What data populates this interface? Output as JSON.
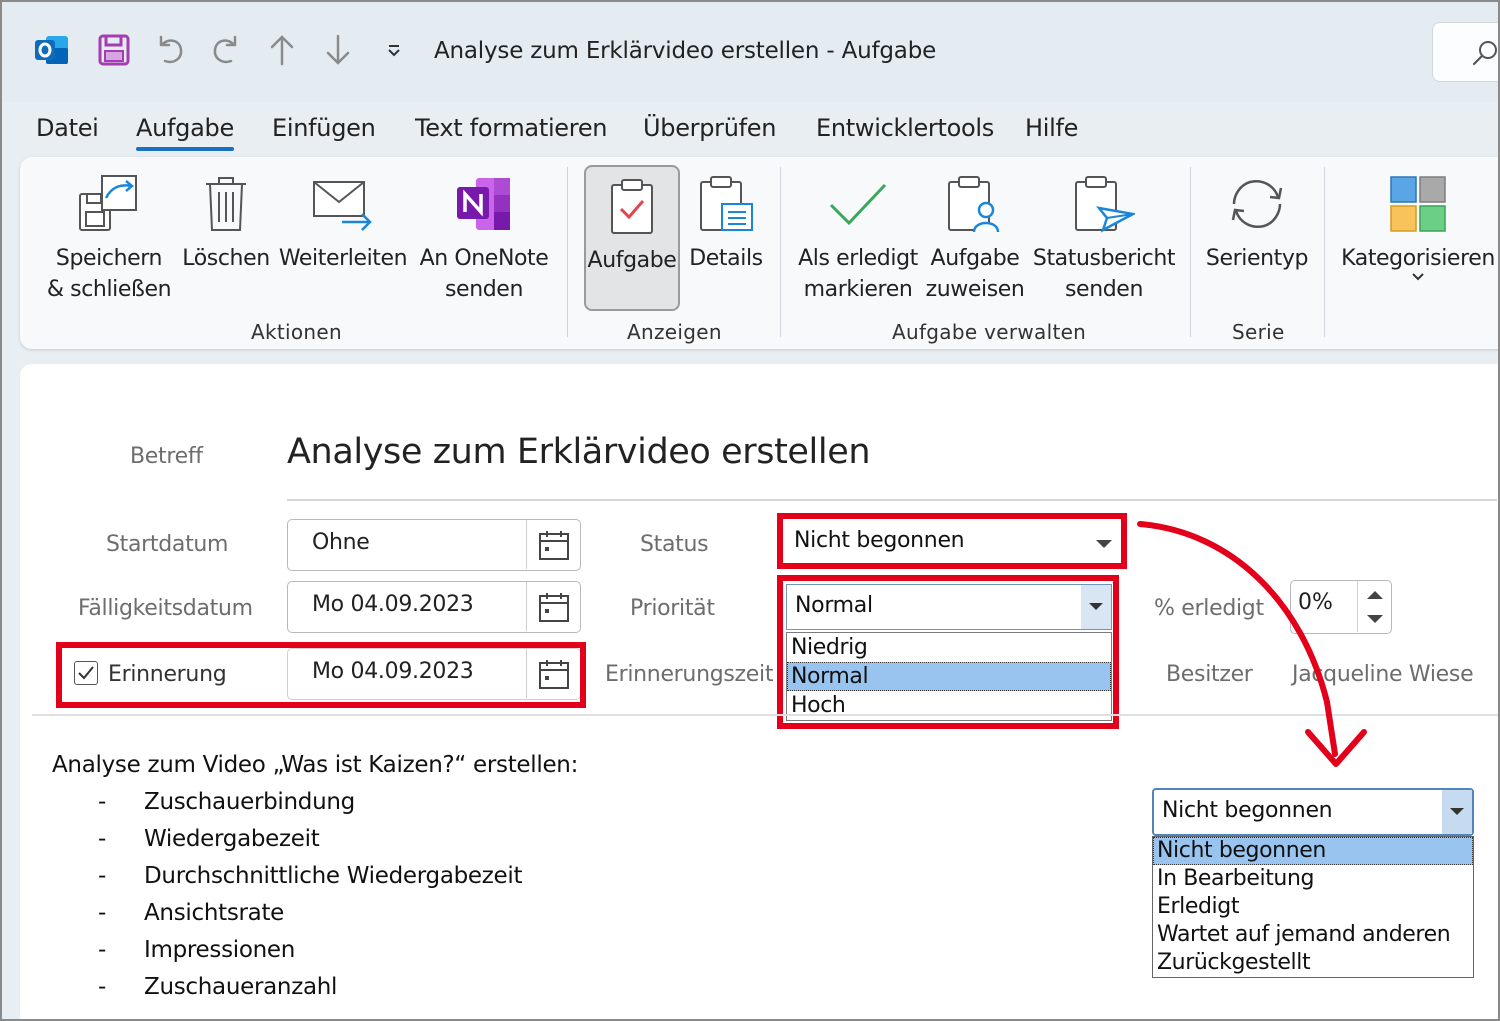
{
  "window": {
    "title": "Analyse zum Erklärvideo erstellen  -  Aufgabe"
  },
  "menu": {
    "tabs": [
      {
        "label": "Datei"
      },
      {
        "label": "Aufgabe",
        "active": true
      },
      {
        "label": "Einfügen"
      },
      {
        "label": "Text formatieren"
      },
      {
        "label": "Überprüfen"
      },
      {
        "label": "Entwicklertools"
      },
      {
        "label": "Hilfe"
      }
    ]
  },
  "ribbon": {
    "buttons": {
      "save_close": "Speichern\n& schließen",
      "delete": "Löschen",
      "forward": "Weiterleiten",
      "onenote": "An OneNote\nsenden",
      "task": "Aufgabe",
      "details": "Details",
      "mark_complete": "Als erledigt\nmarkieren",
      "assign": "Aufgabe\nzuweisen",
      "status_report": "Statusbericht\nsenden",
      "recurrence": "Serientyp",
      "categorize": "Kategorisieren"
    },
    "groups": {
      "actions": "Aktionen",
      "show": "Anzeigen",
      "manage": "Aufgabe verwalten",
      "series": "Serie"
    }
  },
  "form": {
    "subject_label": "Betreff",
    "subject_value": "Analyse zum Erklärvideo erstellen",
    "start_label": "Startdatum",
    "start_value": "Ohne",
    "due_label": "Fälligkeitsdatum",
    "due_value": "Mo 04.09.2023",
    "reminder_label": "Erinnerung",
    "reminder_checked": true,
    "reminder_value": "Mo 04.09.2023",
    "reminder_time_label": "Erinnerungszeit",
    "status_label": "Status",
    "status_value": "Nicht begonnen",
    "priority_label": "Priorität",
    "priority_value": "Normal",
    "priority_options": [
      "Niedrig",
      "Normal",
      "Hoch"
    ],
    "priority_selected": "Normal",
    "percent_label": "% erledigt",
    "percent_value": "0%",
    "owner_label": "Besitzer",
    "owner_value": "Jacqueline Wiese"
  },
  "status_dropdown": {
    "value": "Nicht begonnen",
    "options": [
      "Nicht begonnen",
      "In Bearbeitung",
      "Erledigt",
      "Wartet auf jemand anderen",
      "Zurückgestellt"
    ],
    "selected": "Nicht begonnen"
  },
  "body": {
    "intro": "Analyse zum Video „Was ist Kaizen?“ erstellen:",
    "bullet_marker": "-",
    "items": [
      "Zuschauerbindung",
      "Wiedergabezeit",
      "Durchschnittliche Wiedergabezeit",
      "Ansichtsrate",
      "Impressionen",
      "Zuschaueranzahl"
    ]
  },
  "colors": {
    "highlight_red": "#e2001a",
    "accent_blue": "#1a6fc0",
    "selected_option": "#99c4ef"
  }
}
